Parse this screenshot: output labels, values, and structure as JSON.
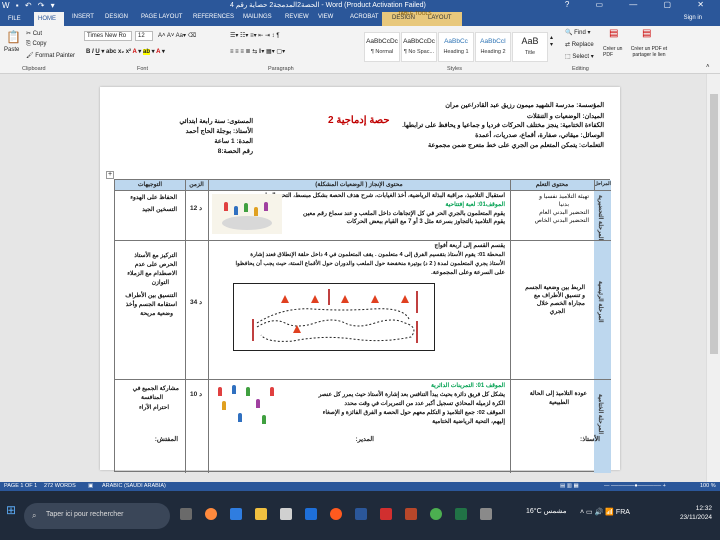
{
  "window": {
    "title": "الحصة2المدمجة2 حصاية رقم 4 - Word (Product Activation Failed)",
    "window_controls": "? ▭ — ▢ ✕"
  },
  "ribbon_tabs": [
    "FILE",
    "HOME",
    "INSERT",
    "DESIGN",
    "PAGE LAYOUT",
    "REFERENCES",
    "MAILINGS",
    "REVIEW",
    "VIEW",
    "ACROBAT",
    "DESIGN",
    "LAYOUT"
  ],
  "context_tab_group": "TABLE TOOLS",
  "signin": "Sign in",
  "ribbon": {
    "clipboard": {
      "paste": "Paste",
      "cut": "Cut",
      "copy": "Copy",
      "format_painter": "Format Painter",
      "label": "Clipboard"
    },
    "font": {
      "name": "Times New Ro",
      "size": "12",
      "label": "Font"
    },
    "paragraph": {
      "label": "Paragraph"
    },
    "styles": {
      "items": [
        {
          "preview": "AaBbCcDc",
          "name": "¶ Normal"
        },
        {
          "preview": "AaBbCcDc",
          "name": "¶ No Spac..."
        },
        {
          "preview": "AaBbCc",
          "name": "Heading 1"
        },
        {
          "preview": "AaBbCcI",
          "name": "Heading 2"
        },
        {
          "preview": "AaB",
          "name": "Title"
        }
      ],
      "label": "Styles"
    },
    "editing": {
      "find": "Find",
      "replace": "Replace",
      "select": "Select",
      "label": "Editing"
    },
    "acrobat": {
      "create_pdf": "Créer un PDF",
      "create_share": "Créer un PDF et partager le lien"
    }
  },
  "document": {
    "header_right": [
      "المؤسسة: مدرسة الشهيد ميمون رزيق عبد القادر/عين مران",
      "الميدان: الوضعيات و التنقلات",
      "الكفاءة الختامية: ينجز مختلف الحركات فرديا و جماعيا و يحافظ على ترابطها.",
      "الوسائل: ميقاتي، صفارة، أقماع، صدريات، أعمدة",
      "التعلمات: يتمكن المتعلم من الجري على خط متعرج ضمن مجموعة"
    ],
    "header_left": [
      "المستوى: سنة رابعة ابتدائي",
      "الأستاذ: بوجلة الحاج أحمد",
      "المدة: 1 ساعة",
      "رقم الحصة:8"
    ],
    "lesson_title": "حصة إدماجية 2",
    "table_headers": {
      "phase": "المراحل",
      "content": "محتوى التعلم",
      "activity": "محتوى الإنجاز ( الوضعيات المشكلة)",
      "time": "الزمن",
      "guidance": "التوجيهات"
    },
    "rows": [
      {
        "phase": "المرحلة التحضيرية",
        "content": [
          "تهيئة التلاميذ نفسيا و",
          "بدنيا",
          "التحضير البدني العام",
          "التحضير البدني الخاص"
        ],
        "activity": [
          "استقبال التلاميذ، مراقبة البذلة الرياضية، أخذ الغيابات، شرح هدف الحصة بشكل مبسط، التحية الرياضية",
          "الموقف01: لعبة إفتتاحية",
          "يقوم المتعلمون بالجري الحر في كل الإتجاهات داخل الملعب و عند سماع رقم معين",
          "يقوم التلاميذ بالتجاوز بسرعة مثل 3 أو 7 مع القيام ببعض الحركات"
        ],
        "time": "12 د",
        "guidance": [
          "الحفاظ على الهدوء",
          "التسخين الجيد"
        ]
      },
      {
        "phase": "المرحلة الرئيسية",
        "content": [
          "الربط بين وضعية الجسم",
          "و تنسيق الأطراف مع",
          "مجاراة الخصم خلال",
          "الجري"
        ],
        "activity": [
          "يقسم القسم إلى أربعة أفواج",
          "المحطة 01: يقوم الأستاذ بتقسيم الفرق إلى 4 متعلمون . يقف المتعلمون في 4 داخل حلقة الإنطلاق فعند إشارة",
          "الأستاذ يجري المتعلمون لمدة ( 2 د) بوتيرة منخفضة حول الملعب والدوران حول الأقماع الستة، حيث يجب أن يحافظوا",
          "على السرعة وعلى المجموعة."
        ],
        "time": "34 د",
        "guidance": [
          "التركيز مع الأستاذ",
          "الحرص على عدم",
          "الاصطدام مع الزملاء",
          "التوازن",
          "التنسيق بين الأطراف",
          "استقامة الجسم وأخذ",
          "وضعية مريحة"
        ]
      },
      {
        "phase": "المرحلة الختامية",
        "content": [
          "عودة التلاميذ إلى الحالة",
          "الطبيعية"
        ],
        "activity": [
          "الموقف 01: التمرينات الدائرية",
          "يشكل كل فريق دائرة بحيث يبدأ التنافس بعد إشارة الأستاذ حيث يمرر كل عنصر",
          "الكرة لزميله المحاذي تسجيل أكبر عدد من التمريرات في وقت محدد",
          "الموقف 02: جمع التلاميذ و التكلم معهم حول الحصة و الفرق الفائزة و الإصغاء",
          "إليهم، التحية الرياضية الختامية"
        ],
        "time": "10 د",
        "guidance": [
          "مشاركة الجميع في",
          "المنافسة",
          "احترام الآراء"
        ]
      }
    ],
    "footer": {
      "teacher": "الأستاذ:",
      "director": "المدير:",
      "inspector": "المفتش:"
    }
  },
  "status_bar": {
    "page": "PAGE 1 OF 1",
    "words": "272 WORDS",
    "lang": "ARABIC (SAUDI ARABIA)",
    "zoom": "100 %"
  },
  "taskbar": {
    "search_placeholder": "Taper ici pour rechercher",
    "weather": "16°C  مشمس",
    "time": "12:32",
    "date": "23/11/2024"
  }
}
